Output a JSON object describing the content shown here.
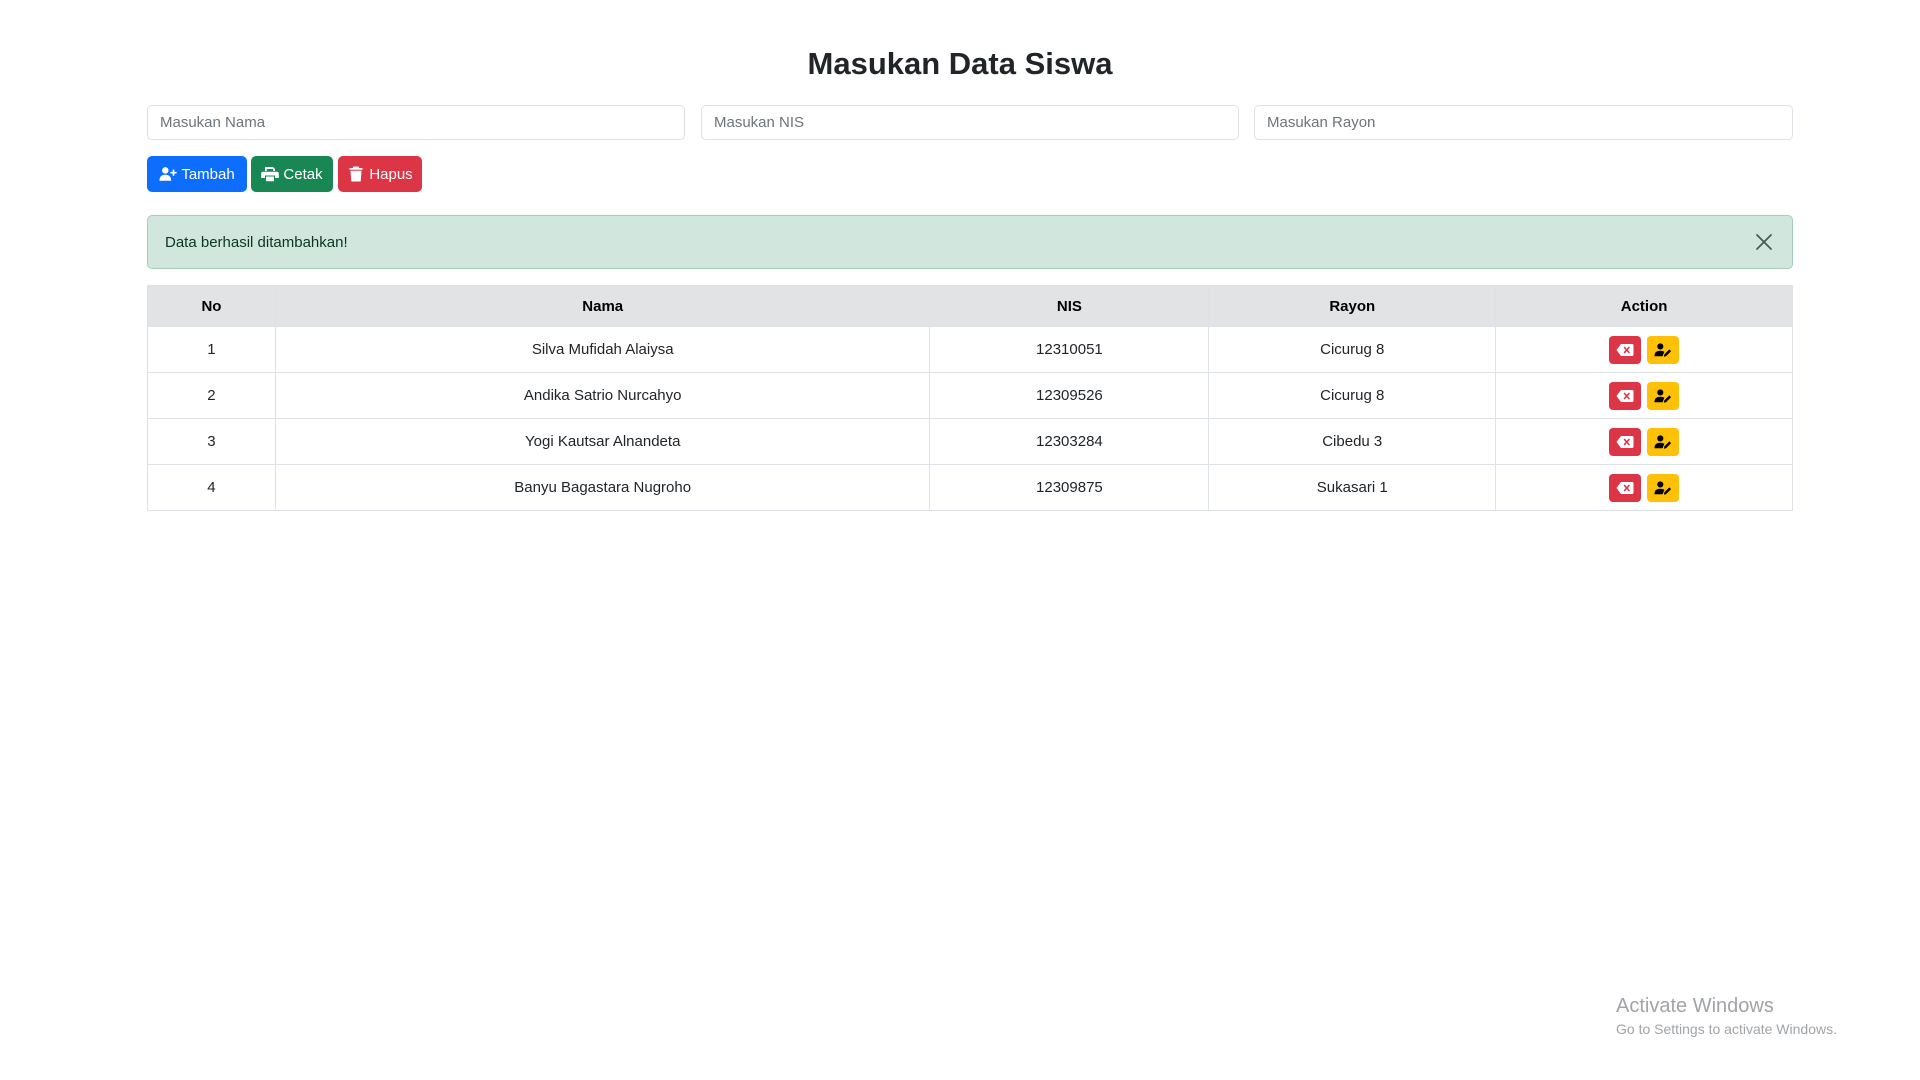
{
  "page": {
    "title": "Masukan Data Siswa"
  },
  "form": {
    "nama_placeholder": "Masukan Nama",
    "nis_placeholder": "Masukan NIS",
    "rayon_placeholder": "Masukan Rayon"
  },
  "buttons": {
    "tambah": "Tambah",
    "cetak": "Cetak",
    "hapus": "Hapus"
  },
  "alert": {
    "message": "Data berhasil ditambahkan!"
  },
  "table": {
    "headers": {
      "no": "No",
      "nama": "Nama",
      "nis": "NIS",
      "rayon": "Rayon",
      "action": "Action"
    },
    "rows": [
      {
        "no": "1",
        "nama": "Silva Mufidah Alaiysa",
        "nis": "12310051",
        "rayon": "Cicurug 8"
      },
      {
        "no": "2",
        "nama": "Andika Satrio Nurcahyo",
        "nis": "12309526",
        "rayon": "Cicurug 8"
      },
      {
        "no": "3",
        "nama": "Yogi Kautsar Alnandeta",
        "nis": "12303284",
        "rayon": "Cibedu 3"
      },
      {
        "no": "4",
        "nama": "Banyu Bagastara Nugroho",
        "nis": "12309875",
        "rayon": "Sukasari 1"
      }
    ]
  },
  "watermark": {
    "title": "Activate Windows",
    "subtitle": "Go to Settings to activate Windows."
  },
  "colors": {
    "primary": "#0d6efd",
    "success": "#198754",
    "danger": "#dc3545",
    "warning": "#ffc107",
    "alert_bg": "#d1e7dd",
    "header_bg": "#e2e3e5"
  },
  "icons": {
    "tambah": "user-plus-icon",
    "cetak": "print-icon",
    "hapus": "trash-icon",
    "row_delete": "delete-left-icon",
    "row_edit": "user-pen-icon",
    "alert_close": "close-icon"
  }
}
